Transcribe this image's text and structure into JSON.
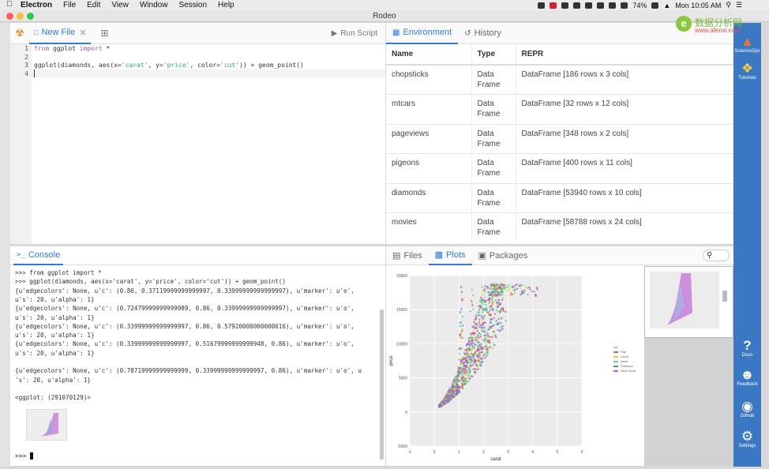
{
  "menubar": {
    "app": "Electron",
    "items": [
      "File",
      "Edit",
      "View",
      "Window",
      "Session",
      "Help"
    ],
    "battery": "74%",
    "clock": "Mon 10:05 AM"
  },
  "window": {
    "title": "Rodeo"
  },
  "editor": {
    "tab_label": "New File",
    "run_label": "Run Script",
    "line_numbers": [
      "1",
      "2",
      "3",
      "4"
    ],
    "line1_kw1": "from",
    "line1_mid": " ggplot ",
    "line1_kw2": "import",
    "line1_end": " *",
    "line3_a": "ggplot(diamonds, aes(x=",
    "line3_s1": "'carat'",
    "line3_b": ", y=",
    "line3_s2": "'price'",
    "line3_c": ", color=",
    "line3_s3": "'cut'",
    "line3_d": ")) + geom_point()"
  },
  "environment": {
    "tabs": [
      "Environment",
      "History"
    ],
    "headers": [
      "Name",
      "Type",
      "REPR"
    ],
    "rows": [
      {
        "name": "chopsticks",
        "type_a": "Data",
        "type_b": "Frame",
        "repr": "DataFrame [186 rows x 3 cols]"
      },
      {
        "name": "mtcars",
        "type_a": "Data",
        "type_b": "Frame",
        "repr": "DataFrame [32 rows x 12 cols]"
      },
      {
        "name": "pageviews",
        "type_a": "Data",
        "type_b": "Frame",
        "repr": "DataFrame [348 rows x 2 cols]"
      },
      {
        "name": "pigeons",
        "type_a": "Data",
        "type_b": "Frame",
        "repr": "DataFrame [400 rows x 11 cols]"
      },
      {
        "name": "diamonds",
        "type_a": "Data",
        "type_b": "Frame",
        "repr": "DataFrame [53940 rows x 10 cols]"
      },
      {
        "name": "movies",
        "type_a": "Data",
        "type_b": "Frame",
        "repr": "DataFrame [58788 rows x 24 cols]"
      }
    ]
  },
  "console": {
    "tab_label": "Console",
    "lines": [
      ">>> from ggplot import *",
      ">>> ggplot(diamonds, aes(x='carat', y='price', color='cut')) + geom_point()",
      "{u'edgecolors': None, u'c': (0.86, 0.37119999999999997, 0.33999999999999997), u'marker': u'o',",
      "u's': 20, u'alpha': 1}",
      "{u'edgecolors': None, u'c': (0.72479999999999989, 0.86, 0.33999999999999997), u'marker': u'o',",
      "u's': 20, u'alpha': 1}",
      "{u'edgecolors': None, u'c': (0.33999999999999997, 0.86, 0.57920000000000016), u'marker': u'o',",
      "u's': 20, u'alpha': 1}",
      "{u'edgecolors': None, u'c': (0.33999999999999997, 0.51679999999999948, 0.86), u'marker': u'o',",
      "u's': 20, u'alpha': 1}",
      "",
      "{u'edgecolors': None, u'c': (0.78719999999999999, 0.33999999999999997, 0.86), u'marker': u'o', u",
      "'s': 20, u'alpha': 1}",
      "",
      "<ggplot: (291070129)>"
    ],
    "prompt": ">>>"
  },
  "plots": {
    "tabs": [
      "Files",
      "Plots",
      "Packages"
    ]
  },
  "chart_data": {
    "type": "scatter",
    "xlabel": "carat",
    "ylabel": "price",
    "xticks": [
      "-1",
      "0",
      "1",
      "2",
      "3",
      "4",
      "5",
      "6"
    ],
    "yticks": [
      "-5000",
      "0",
      "5000",
      "10000",
      "15000",
      "20000"
    ],
    "xlim": [
      -1,
      6
    ],
    "ylim": [
      -5000,
      20000
    ],
    "grid": true,
    "legend_position": "right",
    "legend_title": "cut",
    "series": [
      {
        "name": "Fair",
        "color": "#db5f57"
      },
      {
        "name": "Good",
        "color": "#b9db57"
      },
      {
        "name": "Ideal",
        "color": "#57db94"
      },
      {
        "name": "Premium",
        "color": "#5784db"
      },
      {
        "name": "Very Good",
        "color": "#c957db"
      }
    ]
  },
  "sidebar": {
    "items": [
      {
        "label": "ScienceOps",
        "icon": "scienceops-icon"
      },
      {
        "label": "Tutorials",
        "icon": "python-icon"
      },
      {
        "label": "Docs",
        "icon": "question-icon"
      },
      {
        "label": "Feedback",
        "icon": "people-icon"
      },
      {
        "label": "Github",
        "icon": "github-icon"
      },
      {
        "label": "Settings",
        "icon": "gear-icon"
      }
    ]
  },
  "watermark": {
    "cn": "数据分析网",
    "en": "www.afenxi.com"
  }
}
